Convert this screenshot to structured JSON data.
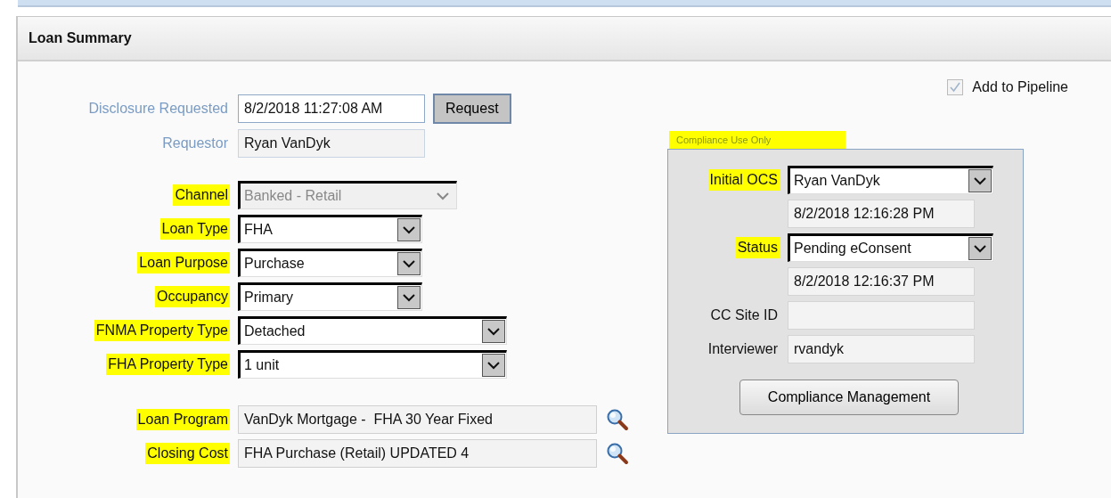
{
  "panel_title": "Loan Summary",
  "add_to_pipeline": {
    "label": "Add to Pipeline",
    "checked": true,
    "disabled": true
  },
  "disclosure": {
    "rows": [
      {
        "label": "Disclosure Requested",
        "value": "8/2/2018 11:27:08 AM",
        "kind": "input"
      },
      {
        "label": "Requestor",
        "value": "Ryan VanDyk",
        "kind": "readonly"
      }
    ],
    "button": "Request"
  },
  "loan_fields": [
    {
      "label": "Channel",
      "value": "Banked - Retail",
      "kind": "combo",
      "disabled": true,
      "highlighted": true
    },
    {
      "label": "Loan Type",
      "value": "FHA",
      "kind": "select",
      "disabled": false,
      "highlighted": true
    },
    {
      "label": "Loan Purpose",
      "value": "Purchase",
      "kind": "select",
      "disabled": false,
      "highlighted": true
    },
    {
      "label": "Occupancy",
      "value": "Primary",
      "kind": "select",
      "disabled": false,
      "highlighted": true
    },
    {
      "label": "FNMA Property Type",
      "value": "Detached",
      "kind": "wideselect",
      "disabled": false,
      "highlighted": true
    },
    {
      "label": "FHA Property Type",
      "value": "1 unit",
      "kind": "wideselect",
      "disabled": false,
      "highlighted": true
    }
  ],
  "program_fields": [
    {
      "label": "Loan Program",
      "value": "VanDyk Mortgage -  FHA 30 Year Fixed",
      "kind": "lookup",
      "highlighted": true
    },
    {
      "label": "Closing Cost",
      "value": "FHA Purchase (Retail) UPDATED 4",
      "kind": "lookup",
      "highlighted": true
    }
  ],
  "compliance": {
    "legend": "Compliance Use Only",
    "legend_highlighted": true,
    "rows": [
      {
        "label": "Initial OCS",
        "value": "Ryan VanDyk",
        "kind": "select",
        "highlighted": true
      },
      {
        "value": "8/2/2018 12:16:28 PM",
        "kind": "readonly"
      },
      {
        "label": "Status",
        "value": "Pending eConsent",
        "kind": "select",
        "highlighted": true
      },
      {
        "value": "8/2/2018 12:16:37 PM",
        "kind": "readonly"
      },
      {
        "label": "CC Site ID",
        "kind": "readonly",
        "highlighted": false
      },
      {
        "label": "Interviewer",
        "value": "rvandyk",
        "kind": "readonly",
        "highlighted": false
      }
    ],
    "button": "Compliance Management"
  }
}
